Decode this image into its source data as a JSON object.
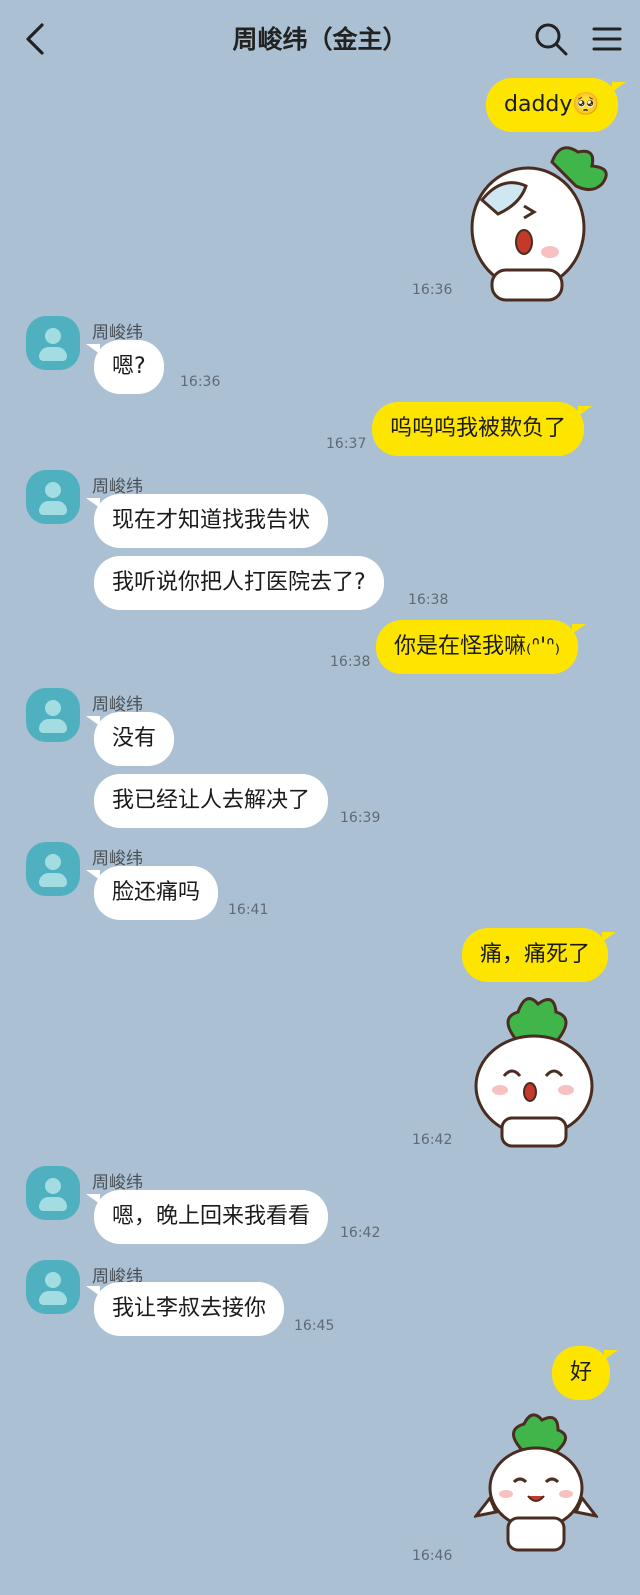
{
  "header": {
    "title": "周峻纬（金主）",
    "back_icon": "chevron-left-icon",
    "search_icon": "search-icon",
    "menu_icon": "hamburger-menu-icon"
  },
  "contact": {
    "name": "周峻纬"
  },
  "colors": {
    "background": "#abc1d3",
    "my_bubble": "#fee500",
    "their_bubble": "#ffffff",
    "avatar": "#4fb1bf",
    "sticker_leaf": "#3fb54a"
  },
  "messages": [
    {
      "from": "me",
      "type": "text",
      "text": "daddy🥺"
    },
    {
      "from": "me",
      "type": "sticker",
      "sticker": "crying-radish-sticker",
      "time": "16:36"
    },
    {
      "from": "them",
      "type": "text",
      "text": "嗯?",
      "time": "16:36"
    },
    {
      "from": "me",
      "type": "text",
      "text": "呜呜呜我被欺负了",
      "time": "16:37"
    },
    {
      "from": "them",
      "type": "text",
      "text": "现在才知道找我告状"
    },
    {
      "from": "them",
      "type": "text",
      "text": "我听说你把人打医院去了?",
      "time": "16:38"
    },
    {
      "from": "me",
      "type": "text",
      "text": "你是在怪我嘛₍ᐢ'ᐢ₎",
      "time": "16:38"
    },
    {
      "from": "them",
      "type": "text",
      "text": "没有"
    },
    {
      "from": "them",
      "type": "text",
      "text": "我已经让人去解决了",
      "time": "16:39"
    },
    {
      "from": "them",
      "type": "text",
      "text": "脸还痛吗",
      "time": "16:41"
    },
    {
      "from": "me",
      "type": "text",
      "text": "痛，痛死了"
    },
    {
      "from": "me",
      "type": "sticker",
      "sticker": "sobbing-radish-sticker",
      "time": "16:42"
    },
    {
      "from": "them",
      "type": "text",
      "text": "嗯，晚上回来我看看",
      "time": "16:42"
    },
    {
      "from": "them",
      "type": "text",
      "text": "我让李叔去接你",
      "time": "16:45"
    },
    {
      "from": "me",
      "type": "text",
      "text": "好"
    },
    {
      "from": "me",
      "type": "sticker",
      "sticker": "happy-radish-sticker",
      "time": "16:46"
    }
  ]
}
